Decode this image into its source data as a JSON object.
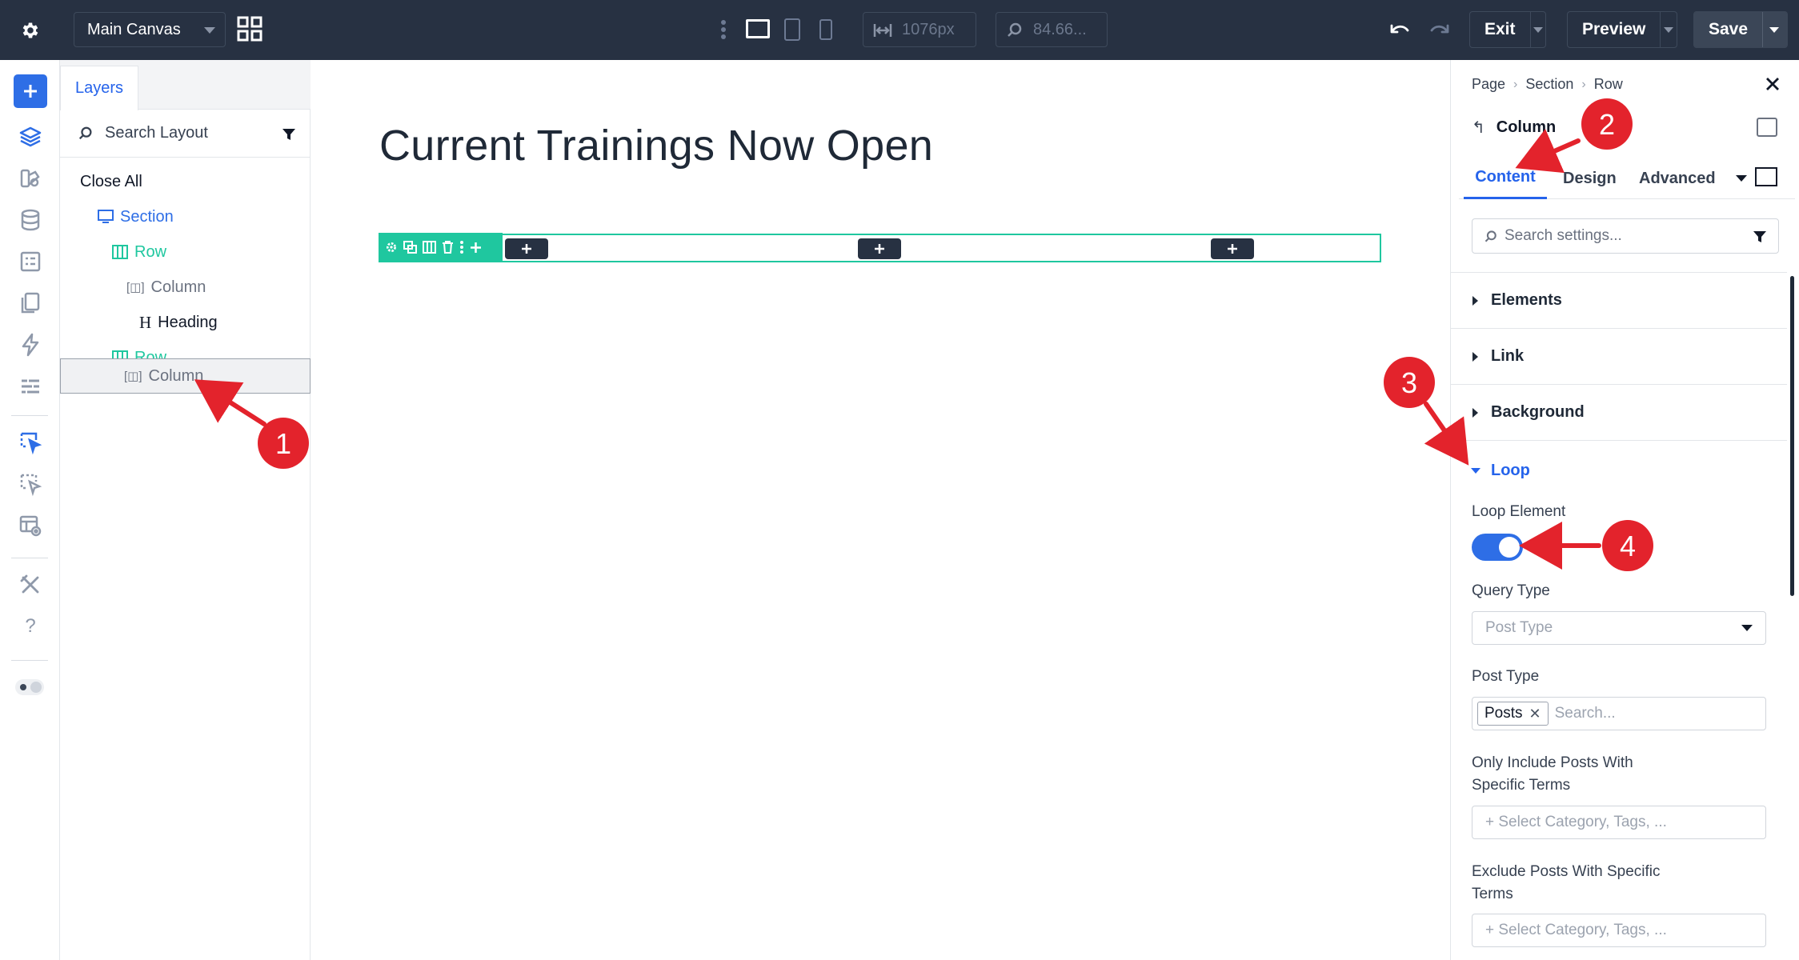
{
  "topbar": {
    "canvas_name": "Main Canvas",
    "width_value": "1076px",
    "zoom_value": "84.66...",
    "exit_label": "Exit",
    "preview_label": "Preview",
    "save_label": "Save"
  },
  "layers_panel": {
    "tab_label": "Layers",
    "search_placeholder": "Search Layout",
    "close_all_label": "Close All",
    "tree": [
      {
        "label": "Section",
        "type": "section"
      },
      {
        "label": "Row",
        "type": "row"
      },
      {
        "label": "Column",
        "type": "column"
      },
      {
        "label": "Heading",
        "type": "heading"
      },
      {
        "label": "Row",
        "type": "row"
      },
      {
        "label": "Column",
        "type": "column",
        "selected": true
      }
    ]
  },
  "canvas": {
    "heading_text": "Current Trainings Now Open"
  },
  "settings_panel": {
    "breadcrumb": [
      "Page",
      "Section",
      "Row"
    ],
    "module_title": "Column",
    "tabs": [
      "Content",
      "Design",
      "Advanced"
    ],
    "active_tab": "Content",
    "search_placeholder": "Search settings...",
    "sections": [
      "Elements",
      "Link",
      "Background",
      "Loop"
    ],
    "open_section": "Loop",
    "loop": {
      "loop_element_label": "Loop Element",
      "loop_element_enabled": true,
      "query_type_label": "Query Type",
      "query_type_placeholder": "Post Type",
      "post_type_label": "Post Type",
      "post_type_chip": "Posts",
      "post_type_search_placeholder": "Search...",
      "include_terms_label_line1": "Only Include Posts With",
      "include_terms_label_line2": "Specific Terms",
      "include_terms_placeholder": "+ Select Category, Tags, ...",
      "exclude_terms_label_line1": "Exclude Posts With Specific",
      "exclude_terms_label_line2": "Terms",
      "exclude_terms_placeholder": "+ Select Category, Tags, ..."
    }
  },
  "annotations": [
    "1",
    "2",
    "3",
    "4"
  ],
  "colors": {
    "topbar_bg": "#273142",
    "accent_blue": "#2e6ee6",
    "row_green": "#1fc79f",
    "annotation_red": "#e3232c"
  }
}
